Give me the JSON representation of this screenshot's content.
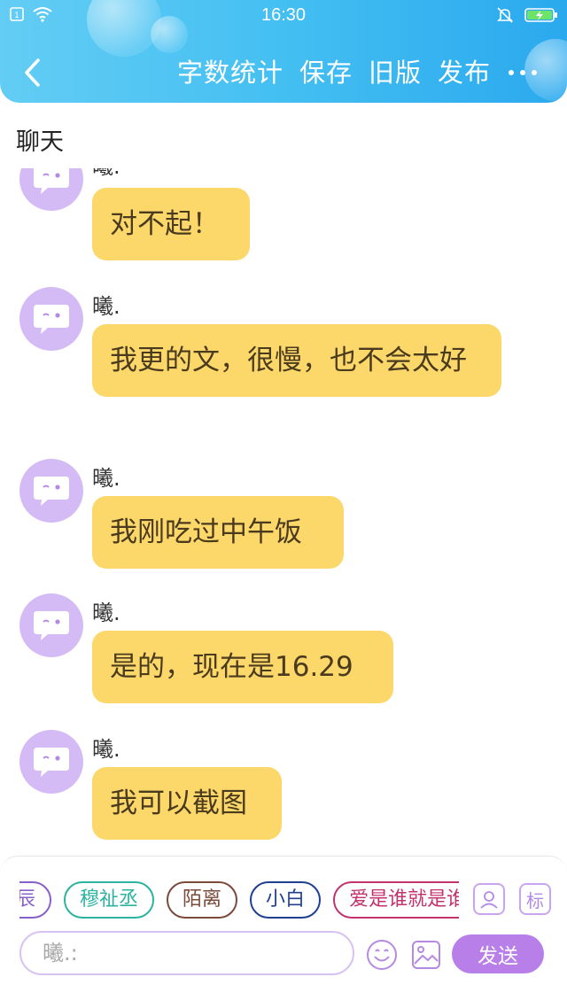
{
  "status_bar": {
    "time": "16:30",
    "icons": [
      "sim-icon",
      "wifi-icon",
      "mute-bell-icon",
      "battery-charging-icon"
    ]
  },
  "nav": {
    "back_icon": "chevron-left-icon",
    "actions": [
      "字数统计",
      "保存",
      "旧版",
      "发布"
    ],
    "more_icon": "more-dots-icon"
  },
  "section_title": "聊天",
  "messages": [
    {
      "sender": "曦.",
      "text": "对不起！"
    },
    {
      "sender": "曦.",
      "text": "我更的文，很慢，也不会太好"
    },
    {
      "sender": "曦.",
      "text": "我刚吃过中午饭"
    },
    {
      "sender": "曦.",
      "text": "是的，现在是16.29"
    },
    {
      "sender": "曦.",
      "text": "我可以截图"
    }
  ],
  "input": {
    "tags": [
      {
        "label": "辰",
        "color": "#8a5fc9"
      },
      {
        "label": "穆祉丞",
        "color": "#2bb3a0"
      },
      {
        "label": "陌离",
        "color": "#7a4a3a"
      },
      {
        "label": "小白",
        "color": "#1f3f8f"
      },
      {
        "label": "爱是谁就是谁",
        "color": "#c2336e"
      }
    ],
    "character_button_icon": "person-card-icon",
    "tag_button_label": "标",
    "placeholder": "曦.:",
    "emoji_icon": "emoji-icon",
    "image_icon": "image-icon",
    "send_label": "发送"
  },
  "colors": {
    "header_gradient_start": "#63cdf4",
    "header_gradient_end": "#2aa9ee",
    "bubble": "#fcd76a",
    "avatar": "#d4bbf5",
    "send_button": "#b97fe8"
  }
}
